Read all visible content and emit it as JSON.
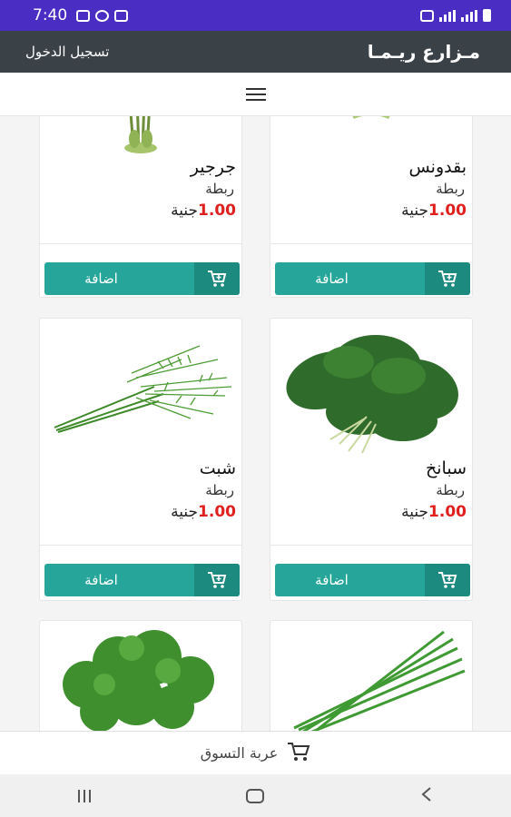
{
  "status_bar": {
    "time": "7:40"
  },
  "header": {
    "brand": "مـزارع ريـمـا",
    "login_label": "تسجيل الدخول"
  },
  "products": [
    {
      "name": "جرجير",
      "unit": "ربطة",
      "price": "1.00",
      "currency": "جنية",
      "add_label": "اضافة"
    },
    {
      "name": "بقدونس",
      "unit": "ربطة",
      "price": "1.00",
      "currency": "جنية",
      "add_label": "اضافة"
    },
    {
      "name": "شبت",
      "unit": "ربطة",
      "price": "1.00",
      "currency": "جنية",
      "add_label": "اضافة"
    },
    {
      "name": "سبانخ",
      "unit": "ربطة",
      "price": "1.00",
      "currency": "جنية",
      "add_label": "اضافة"
    }
  ],
  "cart_bar": {
    "label": "عربة التسوق"
  },
  "colors": {
    "status_bar": "#4a2ec4",
    "header": "#3a4147",
    "button": "#26a69a",
    "price": "#e0201e"
  }
}
